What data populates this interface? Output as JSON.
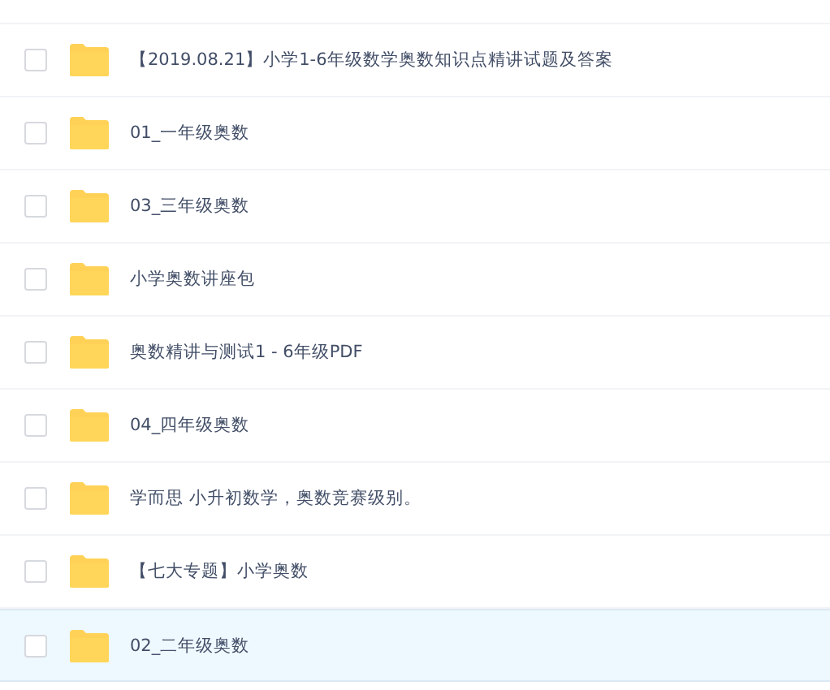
{
  "files": [
    {
      "name": "【2019.08.21】小学1-6年级数学奥数知识点精讲试题及答案",
      "checked": false,
      "hovered": false
    },
    {
      "name": "01_一年级奥数",
      "checked": false,
      "hovered": false
    },
    {
      "name": "03_三年级奥数",
      "checked": false,
      "hovered": false
    },
    {
      "name": "小学奥数讲座包",
      "checked": false,
      "hovered": false
    },
    {
      "name": "奥数精讲与测试1 - 6年级PDF",
      "checked": false,
      "hovered": false
    },
    {
      "name": "04_四年级奥数",
      "checked": false,
      "hovered": false
    },
    {
      "name": "学而思 小升初数学，奥数竞赛级别。",
      "checked": false,
      "hovered": false
    },
    {
      "name": "【七大专题】小学奥数",
      "checked": false,
      "hovered": false
    },
    {
      "name": "02_二年级奥数",
      "checked": false,
      "hovered": true
    }
  ]
}
